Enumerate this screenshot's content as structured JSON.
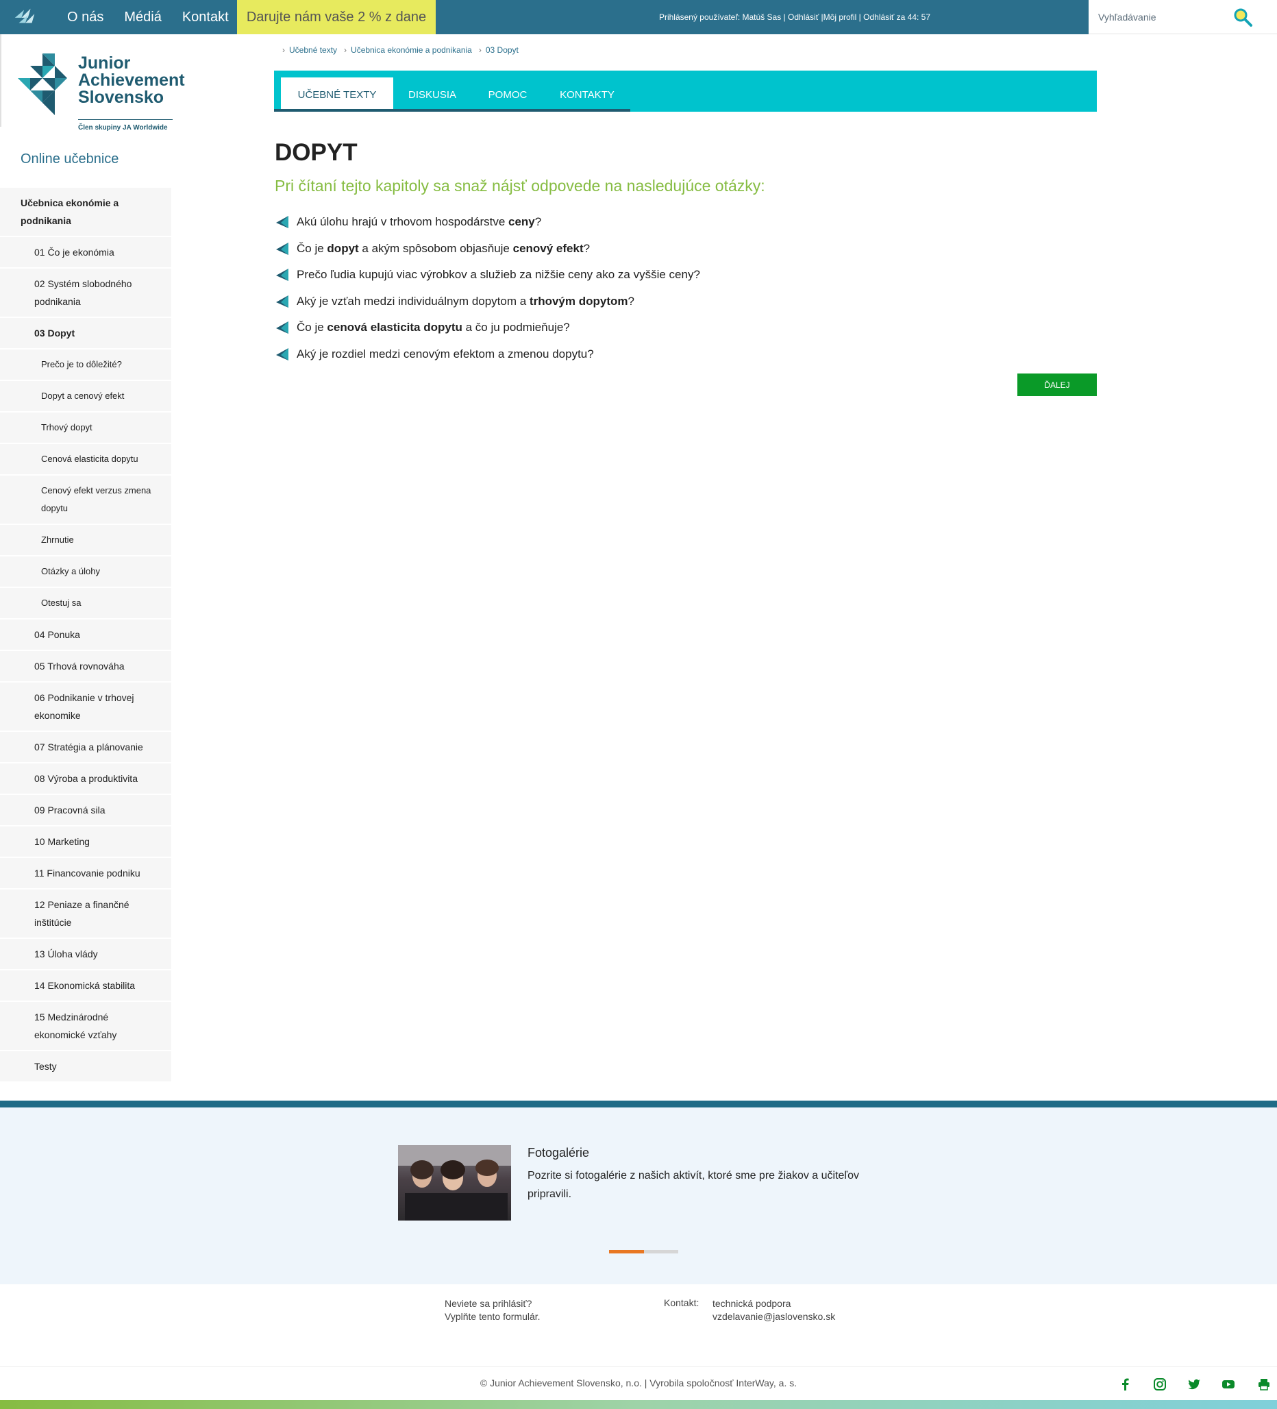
{
  "topbar": {
    "nav": [
      "O nás",
      "Médiá",
      "Kontakt"
    ],
    "donate": "Darujte nám vaše 2 % z dane",
    "user_prefix": "Prihlásený používateľ: ",
    "user_name": "Matúš Sas",
    "sep1": " | ",
    "logout": "Odhlásiť",
    "sep2": " |",
    "profile": "Môj profil",
    "sep3": " | ",
    "logout_timer": "Odhlásiť za 44: 57",
    "search_placeholder": "Vyhľadávanie"
  },
  "logo": {
    "line1": "Junior",
    "line2": "Achievement",
    "line3": "Slovensko",
    "sub": "Člen skupiny JA Worldwide"
  },
  "sidebar": {
    "title": "Online učebnice",
    "items": [
      {
        "label": "Učebnica ekonómie a podnikania",
        "level": 0
      },
      {
        "label": "01 Čo je ekonómia",
        "level": 1
      },
      {
        "label": "02 Systém slobodného podnikania",
        "level": 1
      },
      {
        "label": "03 Dopyt",
        "level": 1,
        "active": true
      },
      {
        "label": "Prečo je to dôležité?",
        "level": 2
      },
      {
        "label": "Dopyt a cenový efekt",
        "level": 2
      },
      {
        "label": "Trhový dopyt",
        "level": 2
      },
      {
        "label": "Cenová elasticita dopytu",
        "level": 2
      },
      {
        "label": "Cenový efekt verzus zmena dopytu",
        "level": 2
      },
      {
        "label": "Zhrnutie",
        "level": 2
      },
      {
        "label": "Otázky a úlohy",
        "level": 2
      },
      {
        "label": "Otestuj sa",
        "level": 2
      },
      {
        "label": "04 Ponuka",
        "level": 1
      },
      {
        "label": "05 Trhová rovnováha",
        "level": 1
      },
      {
        "label": "06 Podnikanie v trhovej ekonomike",
        "level": 1
      },
      {
        "label": "07 Stratégia a plánovanie",
        "level": 1
      },
      {
        "label": "08 Výroba a produktivita",
        "level": 1
      },
      {
        "label": "09 Pracovná sila",
        "level": 1
      },
      {
        "label": "10 Marketing",
        "level": 1
      },
      {
        "label": "11 Financovanie podniku",
        "level": 1
      },
      {
        "label": "12 Peniaze a finančné inštitúcie",
        "level": 1
      },
      {
        "label": "13 Úloha vlády",
        "level": 1
      },
      {
        "label": "14 Ekonomická stabilita",
        "level": 1
      },
      {
        "label": "15 Medzinárodné ekonomické vzťahy",
        "level": 1
      },
      {
        "label": "Testy",
        "level": 1
      }
    ]
  },
  "breadcrumb": [
    "Učebné texty",
    "Učebnica ekonómie a podnikania",
    "03 Dopyt"
  ],
  "tabs": [
    {
      "label": "UČEBNÉ TEXTY",
      "active": true
    },
    {
      "label": "DISKUSIA"
    },
    {
      "label": "POMOC"
    },
    {
      "label": "KONTAKTY"
    }
  ],
  "main": {
    "title": "DOPYT",
    "intro": "Pri čítaní tejto kapitoly sa snaž nájsť odpovede na nasledujúce otázky:",
    "questions": [
      [
        {
          "t": "Akú úlohu hrajú v trhovom hospodárstve "
        },
        {
          "t": "ceny",
          "b": true
        },
        {
          "t": "?"
        }
      ],
      [
        {
          "t": "Čo je "
        },
        {
          "t": "dopyt",
          "b": true
        },
        {
          "t": " a akým spôsobom objasňuje "
        },
        {
          "t": "cenový efekt",
          "b": true
        },
        {
          "t": "?"
        }
      ],
      [
        {
          "t": "Prečo ľudia kupujú viac výrobkov a služieb za nižšie ceny ako za vyššie ceny?"
        }
      ],
      [
        {
          "t": "Aký je vzťah medzi individuálnym dopytom a "
        },
        {
          "t": "trhovým dopytom",
          "b": true
        },
        {
          "t": "?"
        }
      ],
      [
        {
          "t": "Čo je "
        },
        {
          "t": "cenová elasticita dopytu",
          "b": true
        },
        {
          "t": " a čo ju podmieňuje?"
        }
      ],
      [
        {
          "t": "Aký je rozdiel medzi cenovým efektom a zmenou dopytu?"
        }
      ]
    ],
    "next_button": "ĎALEJ"
  },
  "gallery": {
    "title": "Fotogalérie",
    "text": "Pozrite si fotogalérie z našich aktivít, ktoré sme pre žiakov a učiteľov pripravili.",
    "slider_position": 0.5
  },
  "footer": {
    "login_q": "Neviete sa prihlásiť?",
    "login_link": "Vyplňte tento formulár.",
    "contact_label": "Kontakt:",
    "contact_name": "technická podpora",
    "contact_email": "vzdelavanie@jaslovensko.sk",
    "copyright": "© Junior Achievement Slovensko, n.o. | Vyrobila spoločnosť InterWay, a. s.",
    "social": [
      "facebook-icon",
      "instagram-icon",
      "twitter-icon",
      "youtube-icon",
      "print-icon"
    ]
  },
  "colors": {
    "topbar": "#2b6f8c",
    "accent_cyan": "#00c3cd",
    "green_button": "#0a9a28",
    "intro_green": "#86bc42",
    "donate_yellow": "#e7ea5e",
    "slider_active": "#e87722"
  }
}
